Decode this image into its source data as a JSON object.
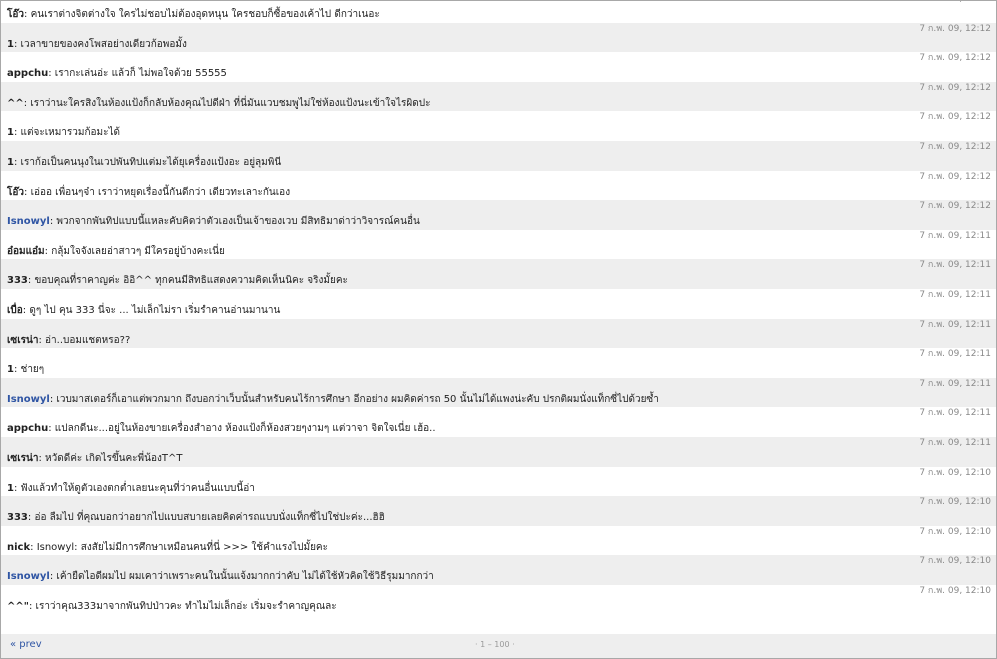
{
  "messages": [
    {
      "author": "โอ๊ว",
      "highlight": false,
      "text": "คนเราต่างจิตต่างใจ ใครไม่ชอบไม่ต้องอุดหนุน ใครชอบก็ซื้อของเค้าไป ดีกว่าเนอะ",
      "time": "7 ก.พ. 09, 12:12"
    },
    {
      "author": "1",
      "highlight": false,
      "text": "เวลาขายของคงโพสอย่างเดียวก้อพอมั้ง",
      "time": "7 ก.พ. 09, 12:12"
    },
    {
      "author": "appchu",
      "highlight": false,
      "text": "เรากะเล่นอ่ะ แล้วก็ ไม่พอใจด้วย 55555",
      "time": "7 ก.พ. 09, 12:12"
    },
    {
      "author": "^^",
      "highlight": false,
      "text": "เราว่านะใครสิงในห้องแป้งก็กลับห้องคุณไปดีฝ่า ที่นี่มันแวบชมพูไม่ใช่ห้องแป้งนะเข้าใจไรผิดปะ",
      "time": "7 ก.พ. 09, 12:12"
    },
    {
      "author": "1",
      "highlight": false,
      "text": "แต่จะเหมารวมก้อมะได้",
      "time": "7 ก.พ. 09, 12:12"
    },
    {
      "author": "1",
      "highlight": false,
      "text": "เราก้อเป็นคนนุงในเวปพันทิปแต่มะได้ยุเครื่องแป้งอะ อยู่ลุมพินี",
      "time": "7 ก.พ. 09, 12:12"
    },
    {
      "author": "โอ๊ว",
      "highlight": false,
      "text": "เอ่ออ เพื่อนๆจ๋า เราว่าหยุดเรื่องนี้กันดีกว่า เดียวทะเลาะกันเอง",
      "time": "7 ก.พ. 09, 12:12"
    },
    {
      "author": "Isnowyl",
      "highlight": true,
      "text": "พวกจากพันทิปแบบนี้แหละคับคิดว่าตัวเองเป็นเจ้าของเวบ มีสิทธิมาด่าว่าวิจารณ์คนอื่น",
      "time": "7 ก.พ. 09, 12:12"
    },
    {
      "author": "อ๋อมแอ๋ม",
      "highlight": false,
      "text": "กลุ้มใจจังเลยอ่าสาวๆ มีใครอยู่บ้างคะเนี่ย",
      "time": "7 ก.พ. 09, 12:11"
    },
    {
      "author": "333",
      "highlight": false,
      "text": "ขอบคุณที่ราคาญค่ะ อิอิ^^ ทุกคนมีสิทธิแสดงความคิดเห็นนิคะ จริงมั้ยคะ",
      "time": "7 ก.พ. 09, 12:11"
    },
    {
      "author": "เบื่อ",
      "highlight": false,
      "text": "ดูๆ ไป คุน 333 นี่จะ ... ไม่เล็กไม่รา เริ่มรำคานอ่านมานาน",
      "time": "7 ก.พ. 09, 12:11"
    },
    {
      "author": "เซเรน่า",
      "highlight": false,
      "text": "อ่า..บอมแชตหรอ??",
      "time": "7 ก.พ. 09, 12:11"
    },
    {
      "author": "1",
      "highlight": false,
      "text": "ช่ายๆ",
      "time": "7 ก.พ. 09, 12:11"
    },
    {
      "author": "Isnowyl",
      "highlight": true,
      "text": "เวบมาสเตอร์ก็เอาแต่พวกมาก ถึงบอกว่าเว็บนั้นสำหรับคนไร้การศึกษา อีกอย่าง ผมคิดค่ารถ 50 นั้นไม่ได้แพงน่ะคับ ปรกติผมนั่งแท็กซี่ไปด้วยซ้ำ",
      "time": "7 ก.พ. 09, 12:11"
    },
    {
      "author": "appchu",
      "highlight": false,
      "text": "แปลกดีนะ...อยู่ในห้องขายเครื่องสำอาง ห้องแป้งก็ห้องสวยๆงามๆ แต่วาจา จิตใจเนี่ย เฮ้อ..",
      "time": "7 ก.พ. 09, 12:11"
    },
    {
      "author": "เซเรน่า",
      "highlight": false,
      "text": "หวัดดีค่ะ เกิดไรขึ้นคะพี่น้องT^T",
      "time": "7 ก.พ. 09, 12:11"
    },
    {
      "author": "1",
      "highlight": false,
      "text": "ฟังแล้วทำให้ดูตัวเองตกต่ำเลยนะคุนที่ว่าคนอื่นแบบนี้อ่า",
      "time": "7 ก.พ. 09, 12:10"
    },
    {
      "author": "333",
      "highlight": false,
      "text": "อ่อ ลืมไป ที่คุณบอกว่าอยากไปแบบสบายเลยคิดค่ารถแบบนั่งแท็กซี่ไปใช่ปะค่ะ...ฮิฮิ",
      "time": "7 ก.พ. 09, 12:10"
    },
    {
      "author": "nick",
      "highlight": false,
      "text": "Isnowyl: สงสัยไม่มีการศึกษาเหมือนคนที่นี่ >>> ใช้คำแรงไปมั้ยคะ",
      "time": "7 ก.พ. 09, 12:10"
    },
    {
      "author": "Isnowyl",
      "highlight": true,
      "text": "เค้ายืดไอดีผมไป ผมเคาว่าเพราะคนในนั้นแจ้งมากกว่าคับ ไม่ได้ใช้หัวคิดใช้วิธีรุมมากกว่า",
      "time": "7 ก.พ. 09, 12:10"
    },
    {
      "author": "^^\"",
      "highlight": false,
      "text": "เราว่าคุณ333มาจากพันทิปป่าวคะ ทำไมไม่เล็กอ่ะ เริ่มจะรำคาญคุณละ",
      "time": "7 ก.พ. 09, 12:10"
    }
  ],
  "pager": {
    "prev_label": "« prev",
    "range_label": "· 1 – 100 ·"
  },
  "colors": {
    "alt_row": "#eeeeee",
    "link": "#2f55a4",
    "timestamp": "#8a8a8a"
  }
}
